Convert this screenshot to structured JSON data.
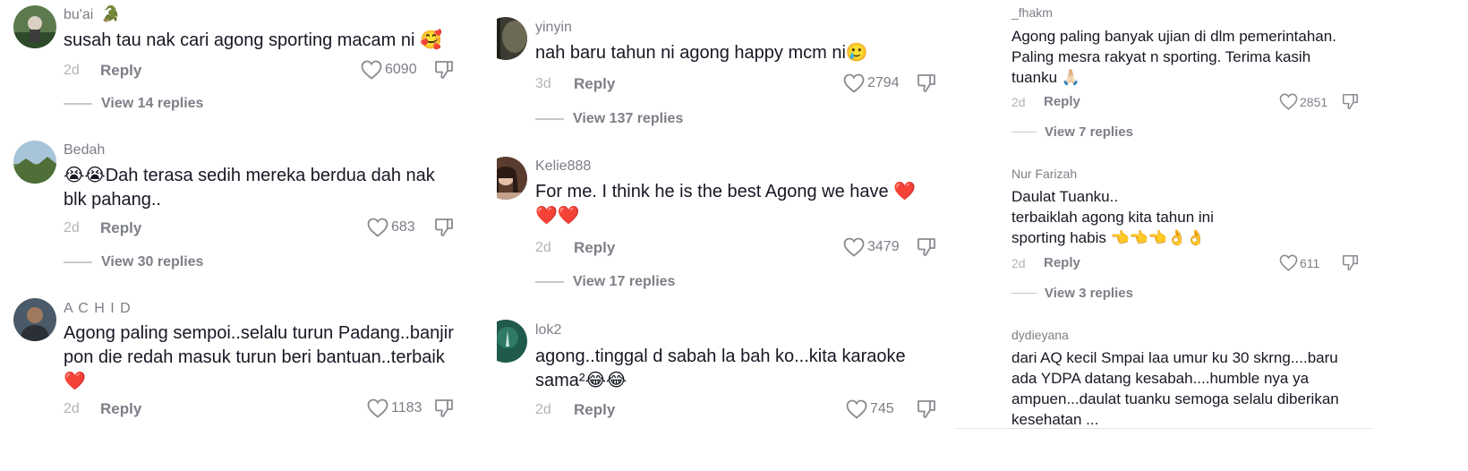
{
  "panels": [
    {
      "comments": [
        {
          "username": "bu'ai",
          "text": "susah tau nak cari agong sporting macam ni 🥰",
          "time": "2d",
          "reply": "Reply",
          "likes": "6090",
          "view_replies": "View 14 replies"
        },
        {
          "username": "Bedah",
          "text": "😭😭Dah terasa sedih mereka berdua dah nak\nblk pahang..",
          "time": "2d",
          "reply": "Reply",
          "likes": "683",
          "view_replies": "View 30 replies"
        },
        {
          "username": "A C H I D",
          "text": "Agong paling sempoi..selalu turun Padang..banjir\npon die redah masuk turun beri bantuan..terbaik\n❤️",
          "time": "2d",
          "reply": "Reply",
          "likes": "1183",
          "view_replies": ""
        }
      ]
    },
    {
      "comments": [
        {
          "username": "yinyin",
          "text": "nah baru tahun ni agong happy mcm ni🥲",
          "time": "3d",
          "reply": "Reply",
          "likes": "2794",
          "view_replies": "View 137 replies"
        },
        {
          "username": "Kelie888",
          "text": "For me. I think he is the best Agong we have ❤️\n❤️❤️",
          "time": "2d",
          "reply": "Reply",
          "likes": "3479",
          "view_replies": "View 17 replies"
        },
        {
          "username": "lok2",
          "text": "agong..tinggal d sabah la bah ko...kita karaoke\nsama²😂😂",
          "time": "2d",
          "reply": "Reply",
          "likes": "745",
          "view_replies": ""
        }
      ]
    },
    {
      "comments": [
        {
          "username": "_fhakm",
          "text": "Agong paling banyak ujian di dlm pemerintahan.\nPaling mesra rakyat n sporting. Terima kasih\ntuanku 🙏🏻",
          "time": "2d",
          "reply": "Reply",
          "likes": "2851",
          "view_replies": "View 7 replies"
        },
        {
          "username": "Nur Farizah",
          "text": "Daulat Tuanku..\nterbaiklah agong kita tahun ini\nsporting habis 👈👈👈👌👌",
          "time": "2d",
          "reply": "Reply",
          "likes": "611",
          "view_replies": "View 3 replies"
        },
        {
          "username": "dydieyana",
          "text": "dari AQ kecil Smpai laa umur ku 30 skrng....baru\nada YDPA datang kesabah....humble nya ya\nampuen...daulat tuanku semoga selalu diberikan\nkesehatan ...",
          "time": "",
          "reply": "",
          "likes": "",
          "view_replies": ""
        }
      ]
    }
  ],
  "icons": {
    "like": "heart-outline-icon",
    "dislike": "thumbs-down-outline-icon",
    "badge": "crocodile-emoji-icon"
  },
  "colors": {
    "username": "#7d7f87",
    "text": "#161823",
    "time": "#b3b4b8",
    "action": "#7d7f87",
    "divider": "#c8c9cc"
  }
}
